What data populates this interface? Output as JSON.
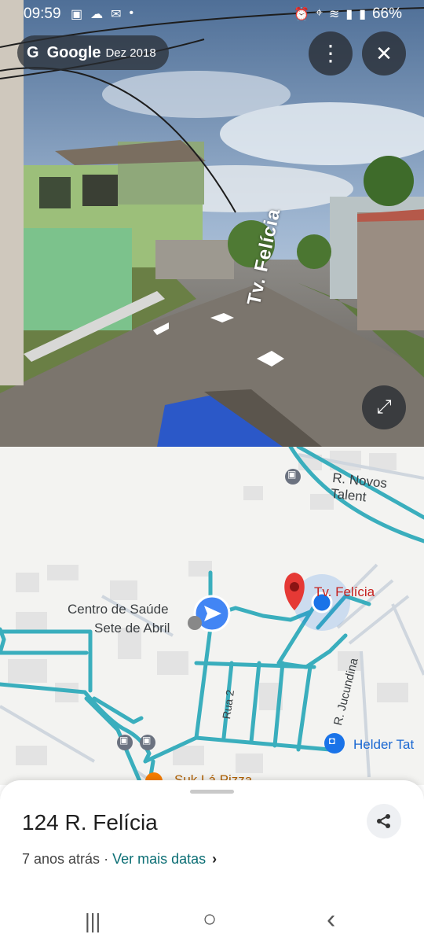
{
  "status_bar": {
    "time": "09:59",
    "battery": "66%",
    "left_icons": [
      "image-icon",
      "cloud-icon",
      "chat-icon",
      "dot-icon"
    ],
    "right_icons": [
      "alarm-icon",
      "location-icon",
      "wifi-icon",
      "signal-icon",
      "signal-icon",
      "battery-icon"
    ]
  },
  "street_view": {
    "brand": "Google",
    "date": "Dez 2018",
    "street_label": "Tv. Felícia",
    "menu_icon": "more-vert-icon",
    "close_icon": "close-icon",
    "expand_icon": "expand-icon"
  },
  "map": {
    "labels": {
      "novos": "R. Novos Talent",
      "felicia": "Tv. Felícia",
      "centro1": "Centro de Saúde",
      "centro2": "Sete de Abril",
      "rua2": "Rua 2",
      "jucundina": "R. Jucundina",
      "helder": "Helder Tat",
      "pizza": "Suk Lá Pizza"
    },
    "colors": {
      "road": "#3aaebd",
      "pin": "#e53935",
      "location": "#1a73e8",
      "background": "#f3f3f1"
    }
  },
  "sheet": {
    "address": "124 R. Felícia",
    "years_ago": "7 anos atrás",
    "separator": " · ",
    "more_dates": "Ver mais datas",
    "chevron": "›"
  },
  "nav_bar": {
    "recent": "|||",
    "home": "○",
    "back": "‹"
  }
}
